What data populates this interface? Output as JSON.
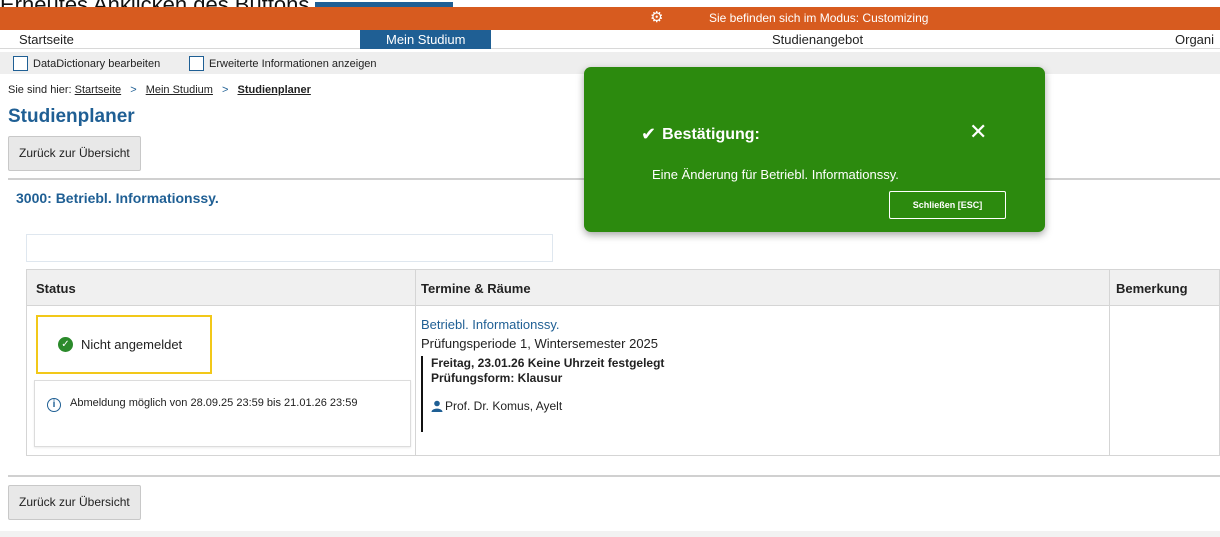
{
  "caption": {
    "text": "Erneutes Anklicken des Buttons"
  },
  "mode_bar": {
    "text": "Sie befinden sich im Modus: Customizing",
    "icon": "gear-icon",
    "color": "#d75b1f"
  },
  "nav": {
    "items": [
      "Startseite",
      "Mein Studium",
      "Studienangebot",
      "Organi"
    ],
    "active": "Mein Studium",
    "accent": "#1f5f94"
  },
  "options": {
    "items": [
      "DataDictionary bearbeiten",
      "Erweiterte Informationen anzeigen"
    ]
  },
  "breadcrumb": {
    "prefix": "Sie sind hier:",
    "items": [
      "Startseite",
      "Mein Studium",
      "Studienplaner"
    ]
  },
  "page": {
    "title": "Studienplaner",
    "back_button": "Zurück zur Übersicht",
    "course_title": "3000: Betriebl. Informationssy.",
    "filter_placeholder": ""
  },
  "table": {
    "headers": [
      "Status",
      "Termine & Räume",
      "Bemerkung"
    ],
    "row": {
      "status": "Nicht angemeldet",
      "info": "Abmeldung möglich von 28.09.25 23:59 bis 21.01.26 23:59",
      "course_link": "Betriebl. Informationssy.",
      "period": "Prüfungsperiode 1, Wintersemester 2025",
      "date_line": "Freitag, 23.01.26 Keine Uhrzeit festgelegt",
      "exam_form": "Prüfungsform: Klausur",
      "professor": "Prof. Dr. Komus, Ayelt"
    }
  },
  "toast": {
    "title": "Bestätigung:",
    "message": "Eine Änderung für Betriebl. Informationssy.",
    "close_button": "Schließen [ESC]",
    "color": "#2c8a0e"
  }
}
